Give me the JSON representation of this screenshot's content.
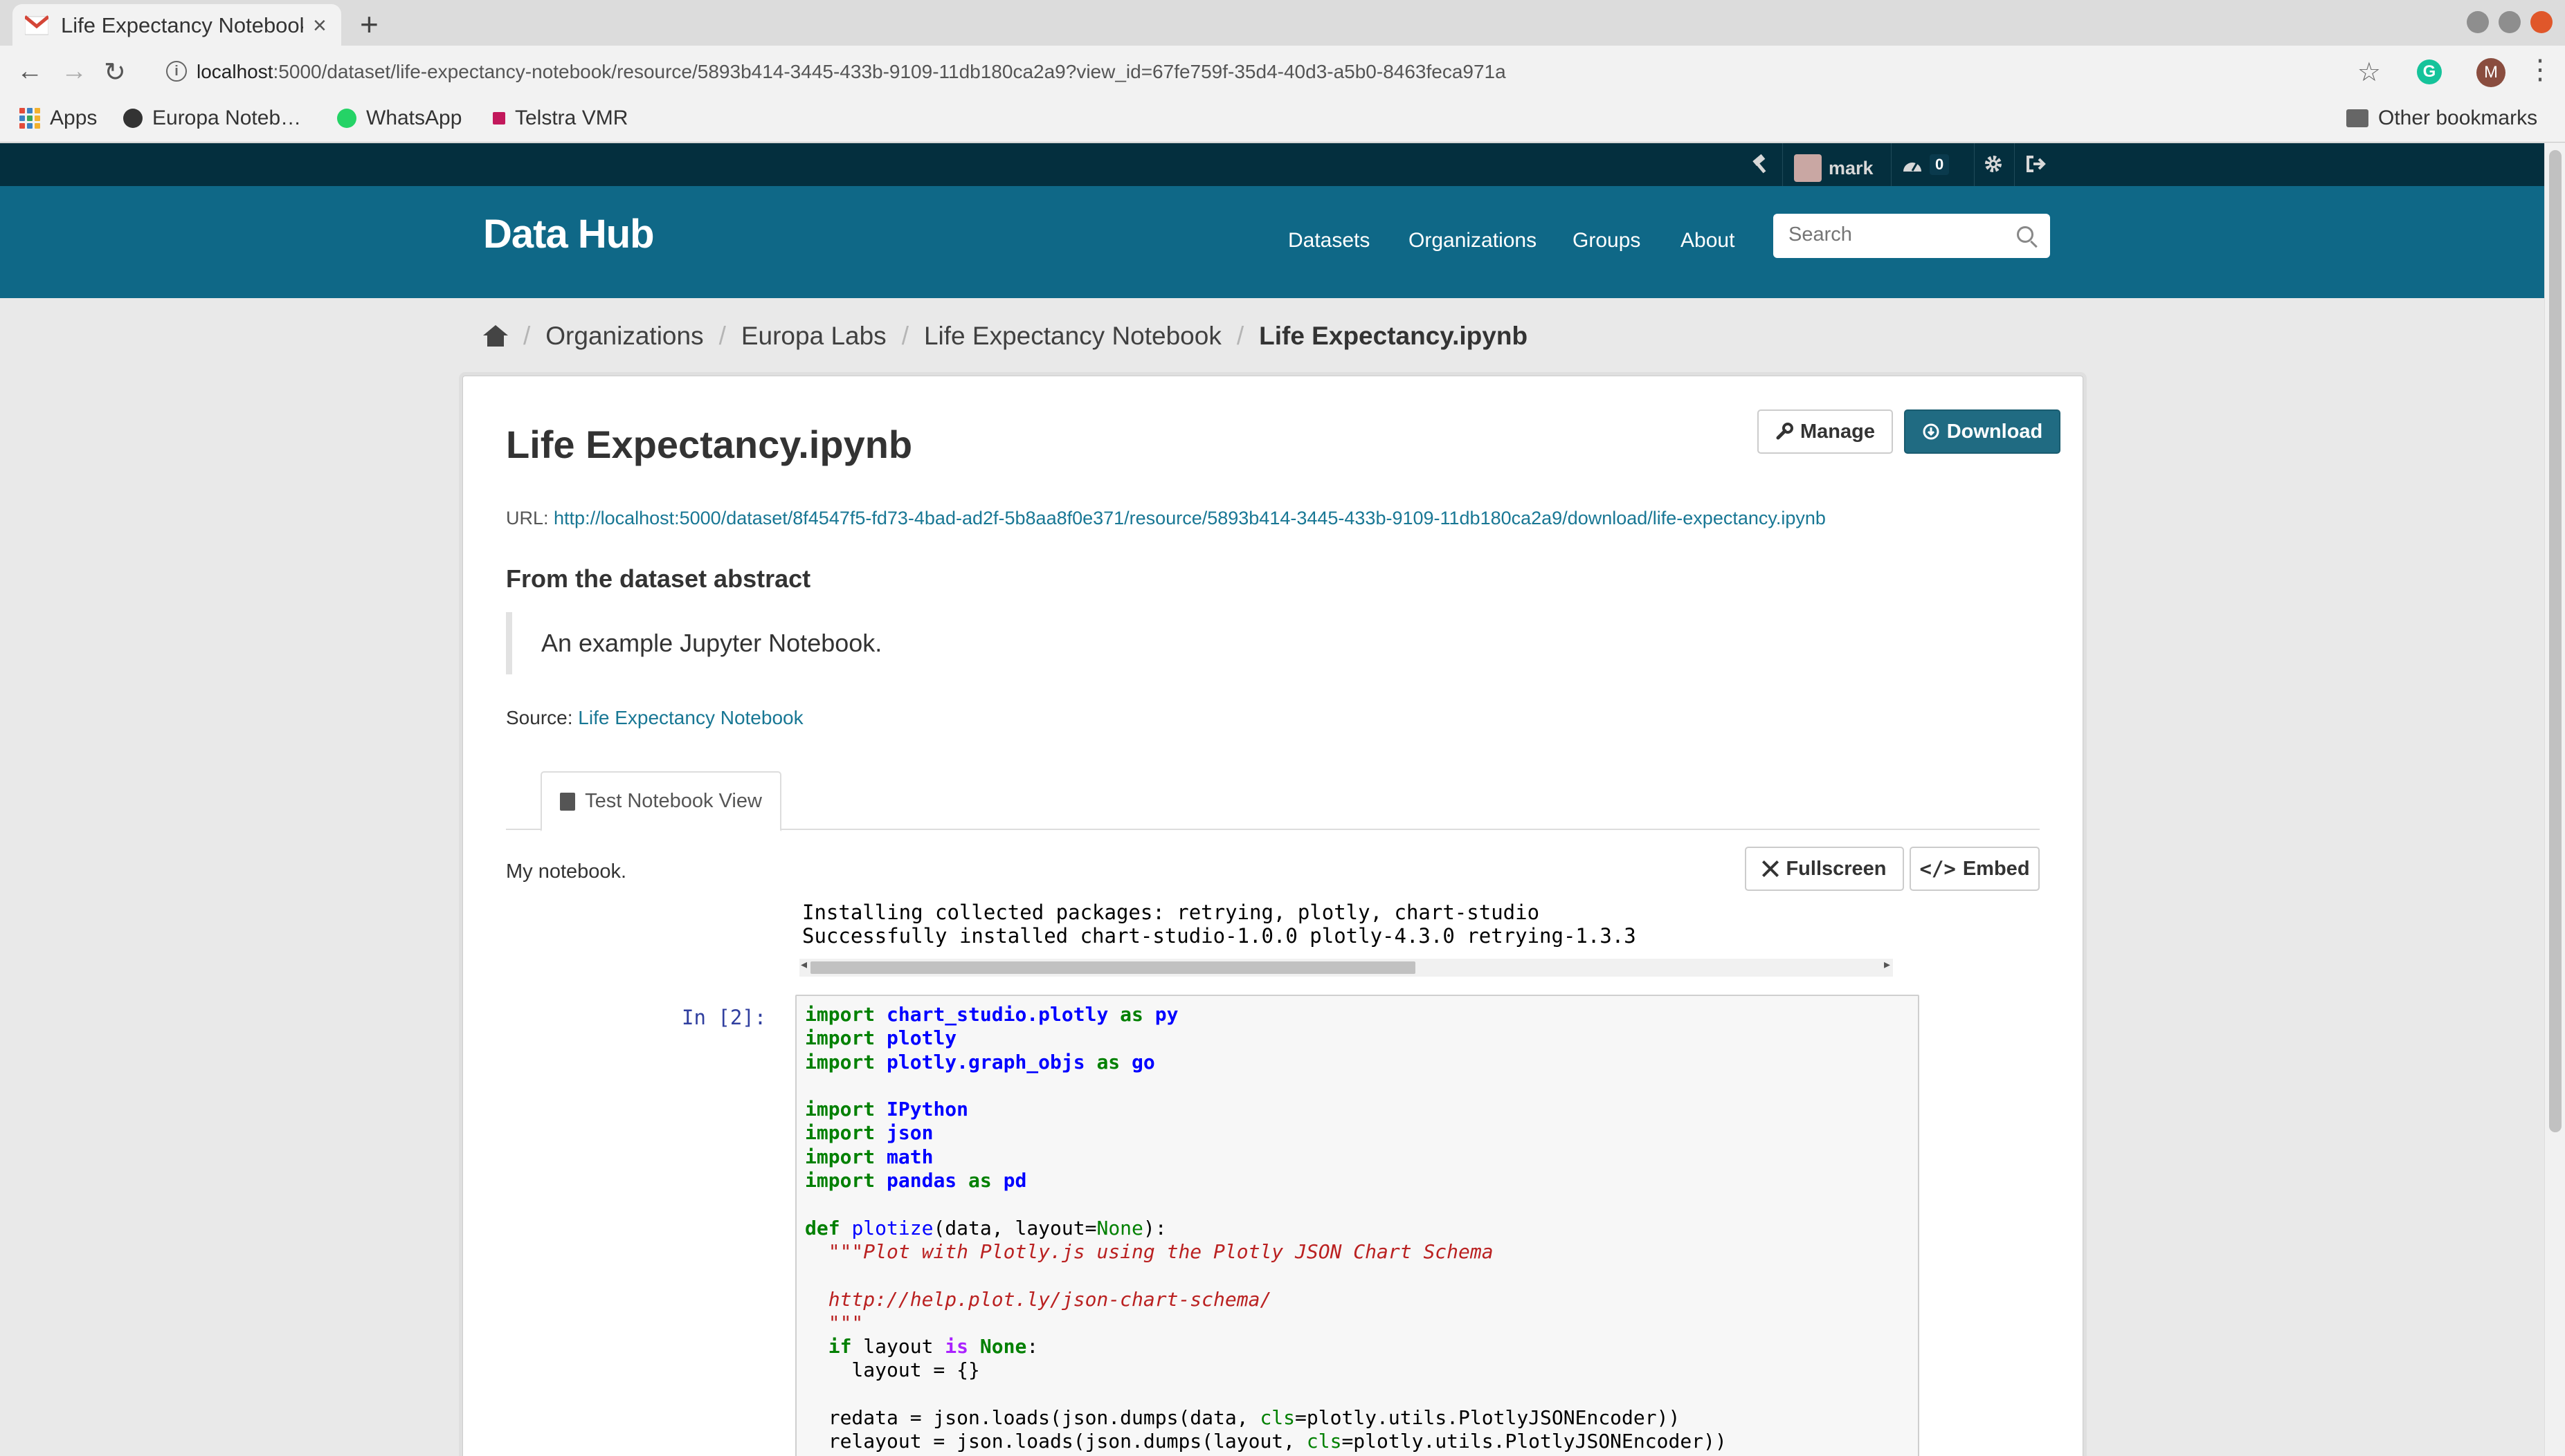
{
  "browser": {
    "tab_title": "Life Expectancy Notebook",
    "tab_close": "×",
    "new_tab": "+",
    "url_host": "localhost",
    "url_rest": ":5000/dataset/life-expectancy-notebook/resource/5893b414-3445-433b-9109-11db180ca2a9?view_id=67fe759f-35d4-40d3-a5b0-8463feca971a",
    "profile_initial": "M",
    "grammarly_letter": "G",
    "bookmarks": [
      "Apps",
      "Europa Noteb…",
      "WhatsApp",
      "Telstra VMR"
    ],
    "other_bookmarks": "Other bookmarks"
  },
  "account": {
    "username": "mark",
    "dashboard_count": "0"
  },
  "masthead": {
    "title": "Data Hub",
    "nav": [
      "Datasets",
      "Organizations",
      "Groups",
      "About"
    ],
    "search_placeholder": "Search"
  },
  "breadcrumb": {
    "items": [
      "Organizations",
      "Europa Labs",
      "Life Expectancy Notebook"
    ],
    "active": "Life Expectancy.ipynb"
  },
  "resource": {
    "title": "Life Expectancy.ipynb",
    "manage_label": "Manage",
    "download_label": "Download",
    "url_label": "URL:",
    "url": "http://localhost:5000/dataset/8f4547f5-fd73-4bad-ad2f-5b8aa8f0e371/resource/5893b414-3445-433b-9109-11db180ca2a9/download/life-expectancy.ipynb",
    "abstract_heading": "From the dataset abstract",
    "abstract_text": "An example Jupyter Notebook.",
    "source_label": "Source:",
    "source_link": "Life Expectancy Notebook",
    "view_tab": "Test Notebook View",
    "view_description": "My notebook.",
    "fullscreen_label": "Fullscreen",
    "embed_label": "Embed"
  },
  "notebook": {
    "output_lines": [
      "Installing collected packages: retrying, plotly, chart-studio",
      "Successfully installed chart-studio-1.0.0 plotly-4.3.0 retrying-1.3.3"
    ],
    "prompt": "In [2]:"
  },
  "colors": {
    "masthead": "#0f6887",
    "account_bar": "#042f3e",
    "primary_button": "#206b82",
    "link": "#187794"
  }
}
